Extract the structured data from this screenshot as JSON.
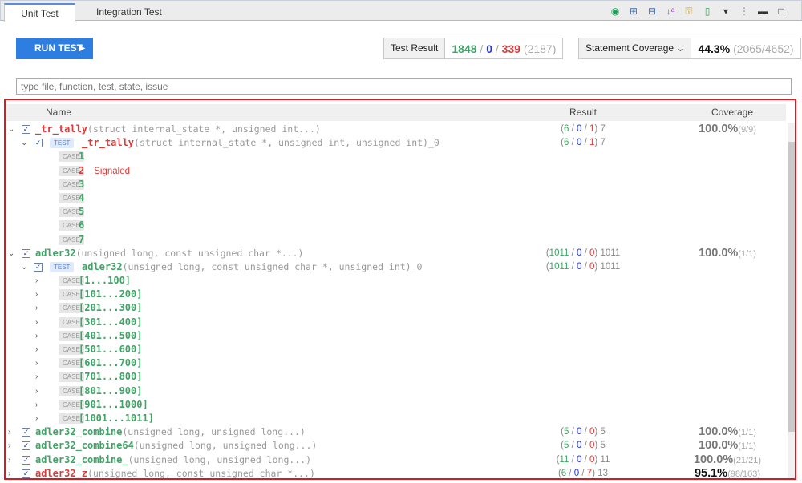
{
  "tabs": [
    {
      "label": "Unit Test",
      "active": true
    },
    {
      "label": "Integration Test",
      "active": false
    }
  ],
  "toolbar_icons": [
    "run-coverage-icon",
    "expand-all-icon",
    "collapse-all-icon",
    "sort-az-icon",
    "key-icon",
    "export-icon",
    "dropdown-icon",
    "more-icon",
    "minimize-icon",
    "maximize-icon"
  ],
  "run_button": "RUN TEST",
  "test_result": {
    "label": "Test Result",
    "passed": "1848",
    "errors": "0",
    "failed": "339",
    "total": "(2187)"
  },
  "coverage": {
    "label": "Statement Coverage",
    "percent": "44.3%",
    "detail": "(2065/4652)"
  },
  "search": {
    "placeholder": "type file, function, test, state, issue"
  },
  "columns": {
    "name": "Name",
    "result": "Result",
    "coverage": "Coverage"
  },
  "colors": {
    "pass": "#3ea465",
    "error": "#2233dd",
    "fail": "#d93a3a",
    "accent": "#2e7de1",
    "highlight": "#e8141c"
  },
  "rows": [
    {
      "level": 0,
      "expand": "open",
      "name": "_tr_tally",
      "sig": "(struct internal_state *, unsigned int...)",
      "status": "fail",
      "res": [
        "6",
        "0",
        "1",
        "7"
      ],
      "cov": "100.0%",
      "covd": "(9/9)"
    },
    {
      "level": 1,
      "expand": "open",
      "badge": "TEST",
      "name": "_tr_tally",
      "sig": "(struct internal_state *, unsigned int, unsigned int)_0",
      "status": "fail",
      "res": [
        "6",
        "0",
        "1",
        "7"
      ]
    },
    {
      "level": 2,
      "badge": "CASE",
      "name": "1",
      "status": "pass"
    },
    {
      "level": 2,
      "badge": "CASE",
      "name": "2",
      "status": "fail",
      "note": "Signaled"
    },
    {
      "level": 2,
      "badge": "CASE",
      "name": "3",
      "status": "pass"
    },
    {
      "level": 2,
      "badge": "CASE",
      "name": "4",
      "status": "pass"
    },
    {
      "level": 2,
      "badge": "CASE",
      "name": "5",
      "status": "pass"
    },
    {
      "level": 2,
      "badge": "CASE",
      "name": "6",
      "status": "pass"
    },
    {
      "level": 2,
      "badge": "CASE",
      "name": "7",
      "status": "pass"
    },
    {
      "level": 0,
      "expand": "open",
      "name": "adler32",
      "sig": "(unsigned long, const unsigned char *...)",
      "status": "pass",
      "res": [
        "1011",
        "0",
        "0",
        "1011"
      ],
      "cov": "100.0%",
      "covd": "(1/1)"
    },
    {
      "level": 1,
      "expand": "open",
      "badge": "TEST",
      "name": "adler32",
      "sig": "(unsigned long, const unsigned char *, unsigned int)_0",
      "status": "pass",
      "res": [
        "1011",
        "0",
        "0",
        "1011"
      ]
    },
    {
      "level": 2,
      "expand": "closed",
      "badge": "CASE",
      "name": "[1...100]",
      "status": "pass"
    },
    {
      "level": 2,
      "expand": "closed",
      "badge": "CASE",
      "name": "[101...200]",
      "status": "pass"
    },
    {
      "level": 2,
      "expand": "closed",
      "badge": "CASE",
      "name": "[201...300]",
      "status": "pass"
    },
    {
      "level": 2,
      "expand": "closed",
      "badge": "CASE",
      "name": "[301...400]",
      "status": "pass"
    },
    {
      "level": 2,
      "expand": "closed",
      "badge": "CASE",
      "name": "[401...500]",
      "status": "pass"
    },
    {
      "level": 2,
      "expand": "closed",
      "badge": "CASE",
      "name": "[501...600]",
      "status": "pass"
    },
    {
      "level": 2,
      "expand": "closed",
      "badge": "CASE",
      "name": "[601...700]",
      "status": "pass"
    },
    {
      "level": 2,
      "expand": "closed",
      "badge": "CASE",
      "name": "[701...800]",
      "status": "pass"
    },
    {
      "level": 2,
      "expand": "closed",
      "badge": "CASE",
      "name": "[801...900]",
      "status": "pass"
    },
    {
      "level": 2,
      "expand": "closed",
      "badge": "CASE",
      "name": "[901...1000]",
      "status": "pass"
    },
    {
      "level": 2,
      "expand": "closed",
      "badge": "CASE",
      "name": "[1001...1011]",
      "status": "pass"
    },
    {
      "level": 0,
      "expand": "closed",
      "name": "adler32_combine",
      "sig": "(unsigned long, unsigned long...)",
      "status": "pass",
      "res": [
        "5",
        "0",
        "0",
        "5"
      ],
      "cov": "100.0%",
      "covd": "(1/1)"
    },
    {
      "level": 0,
      "expand": "closed",
      "name": "adler32_combine64",
      "sig": "(unsigned long, unsigned long...)",
      "status": "pass",
      "res": [
        "5",
        "0",
        "0",
        "5"
      ],
      "cov": "100.0%",
      "covd": "(1/1)"
    },
    {
      "level": 0,
      "expand": "closed",
      "name": "adler32_combine_",
      "sig": "(unsigned long, unsigned long...)",
      "status": "pass",
      "res": [
        "11",
        "0",
        "0",
        "11"
      ],
      "cov": "100.0%",
      "covd": "(21/21)"
    },
    {
      "level": 0,
      "expand": "closed",
      "name": "adler32_z",
      "sig": "(unsigned long, const unsigned char *...)",
      "status": "fail",
      "res": [
        "6",
        "0",
        "7",
        "13"
      ],
      "cov": "95.1%",
      "covd": "(98/103)"
    }
  ]
}
